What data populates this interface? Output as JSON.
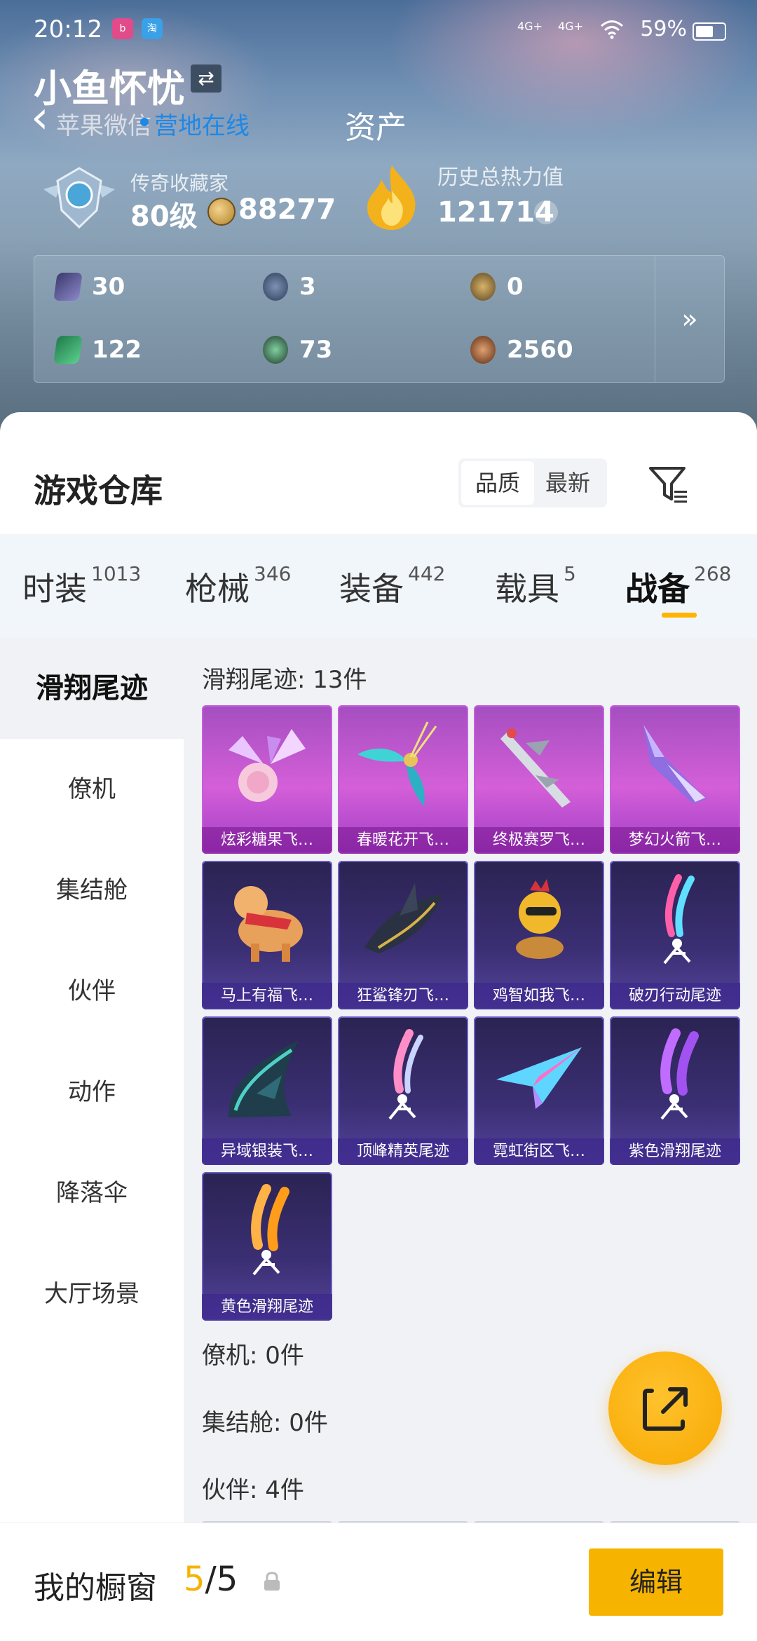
{
  "status_bar": {
    "time": "20:12",
    "network_1": "4G+",
    "network_2": "4G+",
    "battery": "59%"
  },
  "header": {
    "user_name": "小鱼怀忧",
    "platform": "苹果微信",
    "online_status": "营地在线",
    "page_title": "资产",
    "rank_title": "传奇收藏家",
    "rank_level": "80级",
    "coins": "88277",
    "heat_title": "历史总热力值",
    "heat_value": "121714",
    "help": "?"
  },
  "stats": [
    {
      "icon": "card-icon",
      "value": "30"
    },
    {
      "icon": "s-coin-icon",
      "value": "3"
    },
    {
      "icon": "gold-token-icon",
      "value": "0"
    },
    {
      "icon": "ticket-icon",
      "value": "122"
    },
    {
      "icon": "green-coin-icon",
      "value": "73"
    },
    {
      "icon": "bronze-coin-icon",
      "value": "2560"
    }
  ],
  "stats_more": "»",
  "warehouse": {
    "title": "游戏仓库",
    "sort_options": [
      "品质",
      "最新"
    ],
    "sort_selected": "品质"
  },
  "categories": [
    {
      "label": "时装",
      "count": "1013"
    },
    {
      "label": "枪械",
      "count": "346"
    },
    {
      "label": "装备",
      "count": "442"
    },
    {
      "label": "载具",
      "count": "5"
    },
    {
      "label": "战备",
      "count": "268"
    }
  ],
  "active_category": "战备",
  "sidebar": [
    "滑翔尾迹",
    "僚机",
    "集结舱",
    "伙伴",
    "动作",
    "降落伞",
    "大厅场景"
  ],
  "active_sidebar": "滑翔尾迹",
  "sections": {
    "trail_title": "滑翔尾迹: 13件",
    "wingman_title": "僚机: 0件",
    "pod_title": "集结舱: 0件",
    "partner_title": "伙伴: 4件"
  },
  "items": [
    {
      "name": "炫彩糖果飞…",
      "tier": "pink",
      "art": "candy-wings-icon"
    },
    {
      "name": "春暖花开飞…",
      "tier": "pink",
      "art": "butterfly-wings-icon"
    },
    {
      "name": "终极赛罗飞…",
      "tier": "pink",
      "art": "jet-wings-icon"
    },
    {
      "name": "梦幻火箭飞…",
      "tier": "pink",
      "art": "rocket-wings-icon"
    },
    {
      "name": "马上有福飞…",
      "tier": "purple",
      "art": "horse-icon"
    },
    {
      "name": "狂鲨锋刃飞…",
      "tier": "purple",
      "art": "shark-icon"
    },
    {
      "name": "鸡智如我飞…",
      "tier": "purple",
      "art": "chicken-icon"
    },
    {
      "name": "破刃行动尾迹",
      "tier": "purple",
      "art": "rainbow-trail-icon"
    },
    {
      "name": "异域银装飞…",
      "tier": "purple",
      "art": "alien-wings-icon"
    },
    {
      "name": "顶峰精英尾迹",
      "tier": "purple",
      "art": "pink-trail-icon"
    },
    {
      "name": "霓虹街区飞…",
      "tier": "purple",
      "art": "paper-plane-icon"
    },
    {
      "name": "紫色滑翔尾迹",
      "tier": "purple",
      "art": "purple-trail-icon"
    },
    {
      "name": "黄色滑翔尾迹",
      "tier": "purple",
      "art": "yellow-trail-icon"
    }
  ],
  "showcase": {
    "label": "我的橱窗",
    "current": "5",
    "separator": "/",
    "total": "5",
    "edit": "编辑"
  },
  "colors": {
    "accent": "#f6b400",
    "online": "#1e88e5",
    "card_pink": "#c65ee0",
    "card_purple": "#3b2f74"
  }
}
